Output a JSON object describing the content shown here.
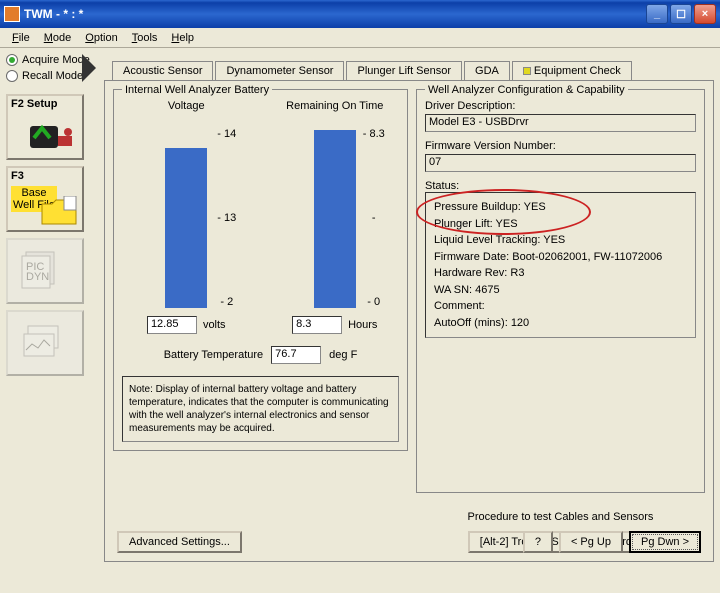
{
  "window": {
    "title": "TWM  -  * : *"
  },
  "menu": {
    "file": "File",
    "mode": "Mode",
    "option": "Option",
    "tools": "Tools",
    "help": "Help"
  },
  "radios": {
    "acquire": "Acquire Mode",
    "recall": "Recall Mode"
  },
  "side": {
    "f2": "F2",
    "setup": "Setup",
    "f3": "F3",
    "base": "Base",
    "wellfile": "Well File"
  },
  "tabs": {
    "acoustic": "Acoustic Sensor",
    "dyn": "Dynamometer Sensor",
    "plunger": "Plunger Lift Sensor",
    "gda": "GDA",
    "equip": "Equipment Check"
  },
  "battery": {
    "legend": "Internal Well Analyzer Battery",
    "voltage_label": "Voltage",
    "voltage_ticks_top": "14",
    "voltage_ticks_mid": "13",
    "voltage_ticks_bot": "2",
    "voltage_value": "12.85",
    "voltage_unit": "volts",
    "remain_label": "Remaining On Time",
    "remain_ticks_top": "8.3",
    "remain_ticks_bot": "0",
    "remain_value": "8.3",
    "remain_unit": "Hours",
    "temp_label": "Battery Temperature",
    "temp_value": "76.7",
    "temp_unit": "deg F",
    "note": "Note:  Display of internal battery voltage and battery temperature, indicates that the computer is communicating with the well analyzer's internal electronics and sensor measurements may be acquired."
  },
  "config": {
    "legend": "Well Analyzer Configuration & Capability",
    "driver_label": "Driver Description:",
    "driver_value": "Model E3 - USBDrvr",
    "fw_label": "Firmware Version Number:",
    "fw_value": "07",
    "status_label": "Status:",
    "s1": "Pressure Buildup: YES",
    "s2": "Plunger Lift: YES",
    "s3": "Liquid Level Tracking: YES",
    "s4": "Firmware Date: Boot-02062001, FW-11072006",
    "s5": "Hardware Rev: R3",
    "s6": "WA SN: 4675",
    "s7": "Comment:",
    "s8": "AutoOff (mins): 120",
    "proc_label": "Procedure to test Cables and Sensors",
    "proc_btn": "[Alt-2]  Trouble Shooting Wizard..."
  },
  "buttons": {
    "adv": "Advanced Settings...",
    "help": "?",
    "pgup": "< Pg Up",
    "pgdn": "Pg Dwn >"
  },
  "chart_data": [
    {
      "type": "bar",
      "categories": [
        "Voltage"
      ],
      "values": [
        12.85
      ],
      "ylim": [
        2,
        14
      ],
      "ylabel": "volts",
      "title": "Voltage"
    },
    {
      "type": "bar",
      "categories": [
        "Remaining On Time"
      ],
      "values": [
        8.3
      ],
      "ylim": [
        0,
        8.3
      ],
      "ylabel": "Hours",
      "title": "Remaining On Time"
    }
  ]
}
